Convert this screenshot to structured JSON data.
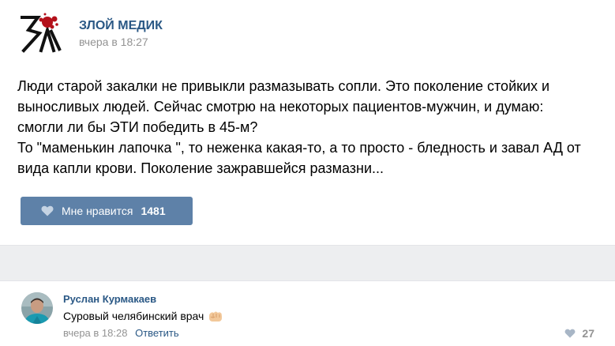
{
  "post": {
    "author": "ЗЛОЙ МЕДИК",
    "time": "вчера в 18:27",
    "avatar_icon": "evil-medic-logo-icon",
    "text_lines": [
      "Люди старой закалки не привыкли размазывать сопли. Это поколение стойких и",
      "выносливых людей. Сейчас смотрю на некоторых пациентов-мужчин, и думаю:",
      "смогли ли бы ЭТИ победить в 45-м?",
      "То \"маменькин лапочка \", то неженка какая-то, а то просто - бледность и завал АД от",
      "вида капли крови. Поколение зажравшейся размазни..."
    ],
    "like_button": {
      "label": "Мне нравится",
      "count": "1481",
      "icon": "heart-icon"
    }
  },
  "comment": {
    "author": "Руслан Курмакаев",
    "text": "Суровый челябинский врач",
    "emoji_icon": "fist-emoji-icon",
    "time": "вчера в 18:28",
    "reply_label": "Ответить",
    "likes": "27",
    "likes_icon": "heart-icon"
  },
  "colors": {
    "link": "#2a5885",
    "like_button_bg": "#5e81a8",
    "muted": "#939393",
    "band": "#edeef0"
  }
}
